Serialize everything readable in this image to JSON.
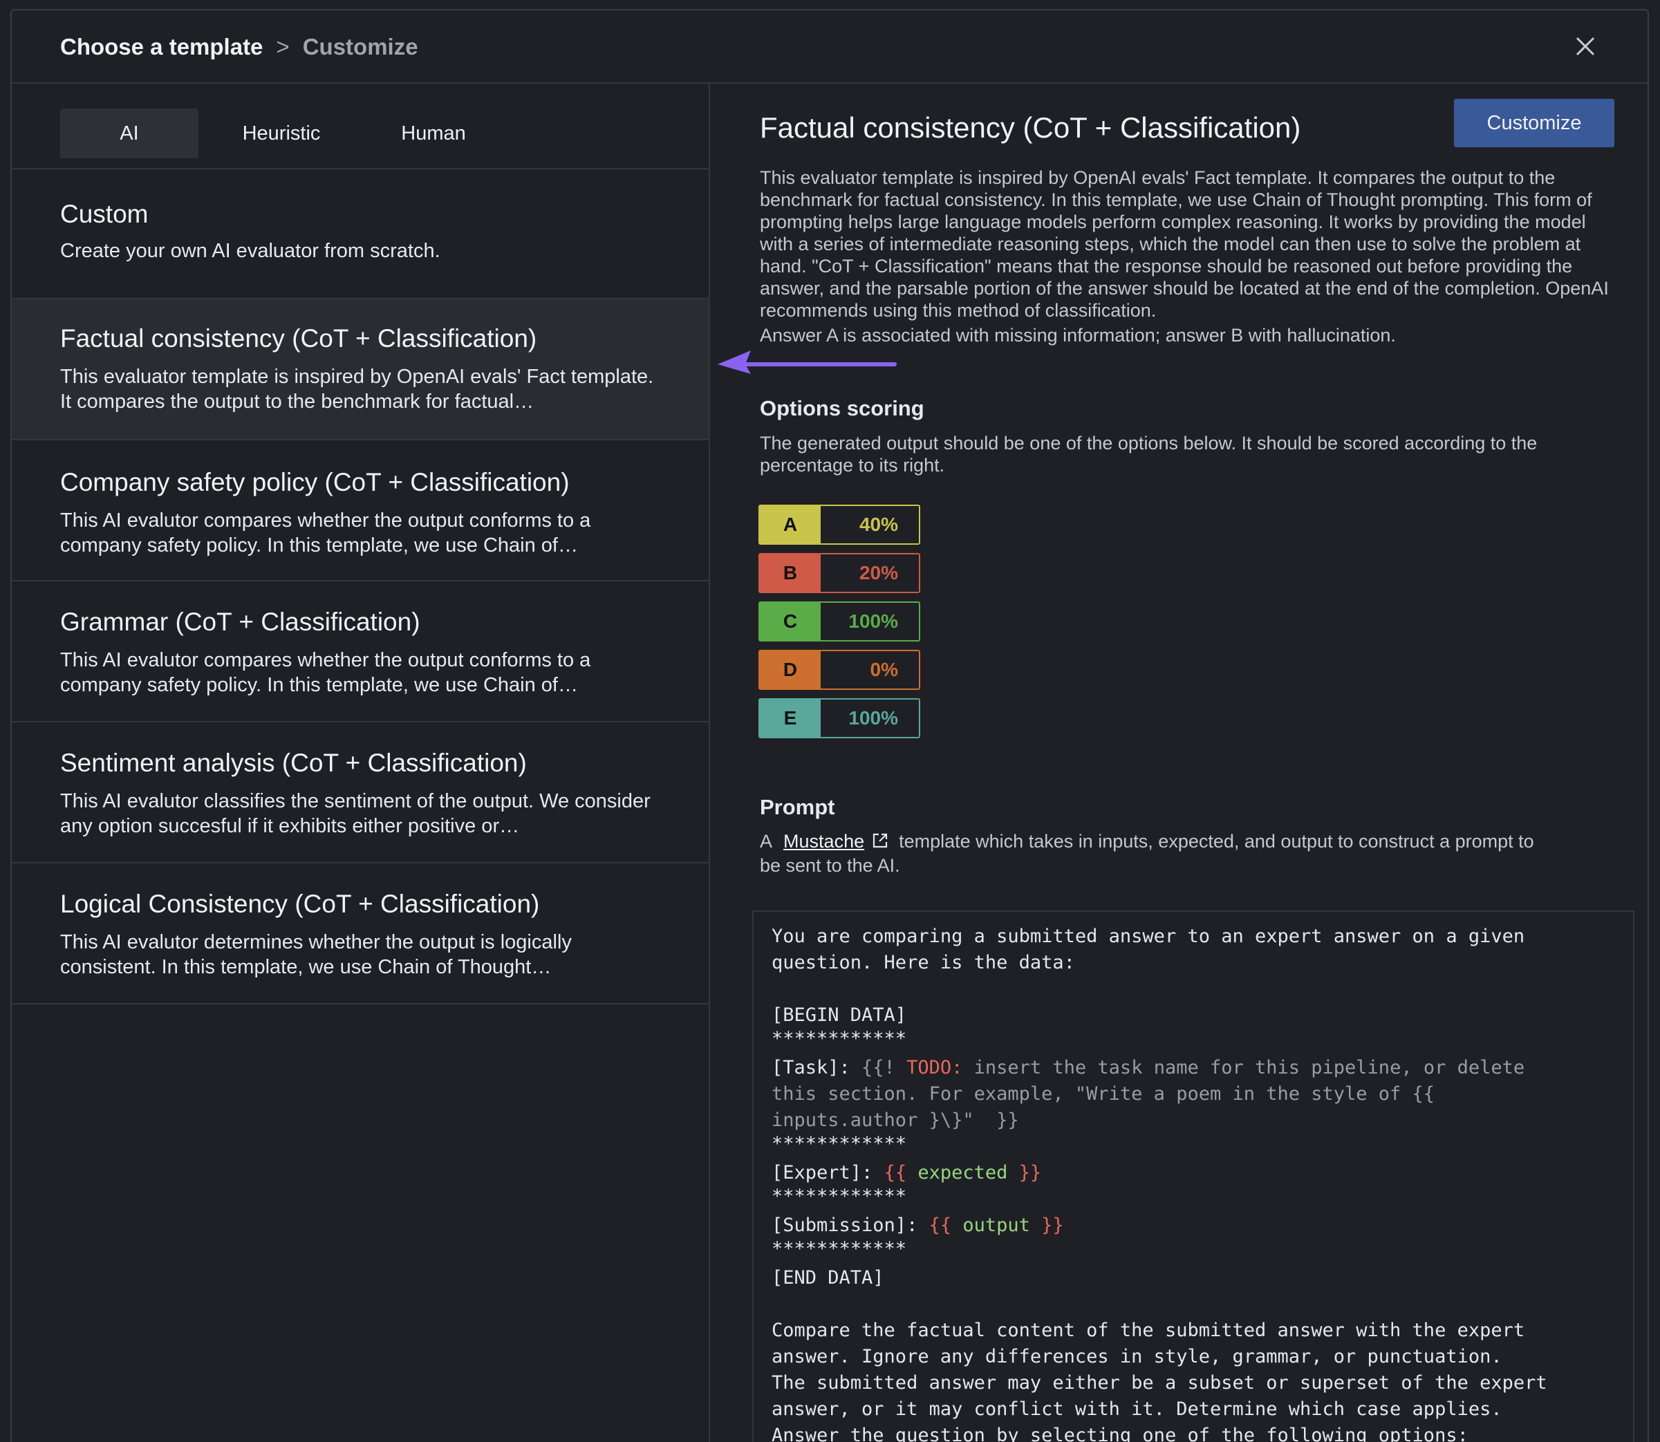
{
  "header": {
    "breadcrumb_current": "Choose a template",
    "breadcrumb_separator": ">",
    "breadcrumb_next": "Customize",
    "close_icon": "close-icon"
  },
  "tabs": [
    {
      "label": "AI",
      "active": true
    },
    {
      "label": "Heuristic",
      "active": false
    },
    {
      "label": "Human",
      "active": false
    }
  ],
  "templates": [
    {
      "title": "Custom",
      "description": "Create your own AI evaluator from scratch."
    },
    {
      "title": "Factual consistency (CoT + Classification)",
      "description": "This evaluator template is inspired by OpenAI evals' Fact template. It compares the output to the benchmark for factual…",
      "selected": true
    },
    {
      "title": "Company safety policy (CoT + Classification)",
      "description": "This AI evalutor compares whether the output conforms to a company safety policy. In this template, we use Chain of…"
    },
    {
      "title": "Grammar (CoT + Classification)",
      "description": "This AI evalutor compares whether the output conforms to a company safety policy. In this template, we use Chain of…"
    },
    {
      "title": "Sentiment analysis (CoT + Classification)",
      "description": "This AI evalutor classifies the sentiment of the output. We consider any option succesful if it exhibits either positive or…"
    },
    {
      "title": "Logical Consistency (CoT + Classification)",
      "description": "This AI evalutor determines whether the output is logically consistent. In this template, we use Chain of Thought…"
    }
  ],
  "detail": {
    "title": "Factual consistency (CoT + Classification)",
    "customize_label": "Customize",
    "description": "This evaluator template is inspired by OpenAI evals' Fact template. It compares the output to the benchmark for factual consistency. In this template, we use Chain of Thought prompting. This form of prompting helps large language models perform complex reasoning. It works by providing the model with a series of intermediate reasoning steps, which the model can then use to solve the problem at hand. \"CoT + Classification\" means that the response should be reasoned out before providing the answer, and the parsable portion of the answer should be located at the end of the completion. OpenAI recommends using this method of classification.",
    "note": "Answer A is associated with missing information; answer B with hallucination."
  },
  "options_scoring": {
    "heading": "Options scoring",
    "description": "The generated output should be one of the options below. It should be scored according to the percentage to its right.",
    "options": [
      {
        "letter": "A",
        "percent": "40%",
        "color": "#c9c44a"
      },
      {
        "letter": "B",
        "percent": "20%",
        "color": "#cf5a48"
      },
      {
        "letter": "C",
        "percent": "100%",
        "color": "#5aac48"
      },
      {
        "letter": "D",
        "percent": "0%",
        "color": "#cd6f2e"
      },
      {
        "letter": "E",
        "percent": "100%",
        "color": "#5aa79c"
      }
    ]
  },
  "prompt": {
    "heading": "Prompt",
    "desc_prefix": "A",
    "link_label": "Mustache",
    "desc_suffix": "template which takes in inputs, expected, and output to construct a prompt to",
    "desc_line2": "be sent to the AI.",
    "code": {
      "l1": "You are comparing a submitted answer to an expert answer on a given",
      "l2": "question. Here is the data:",
      "l3": "[BEGIN DATA]",
      "stars": "************",
      "task_label": "[Task]: ",
      "task_open": "{{! ",
      "task_todo": "TODO:",
      "task_text1": " insert the task name for this pipeline, or delete",
      "task_text2": "this section. For example, \"Write a poem in the style of {{",
      "task_text3": "inputs.author }\\}\"  }}",
      "expert_label": "[Expert]: ",
      "var_open": "{{",
      "var_expected": " expected ",
      "var_close": "}}",
      "submission_label": "[Submission]: ",
      "var_output": " output ",
      "end": "[END DATA]",
      "c1": "Compare the factual content of the submitted answer with the expert",
      "c2": "answer. Ignore any differences in style, grammar, or punctuation.",
      "c3": "The submitted answer may either be a subset or superset of the expert",
      "c4": "answer, or it may conflict with it. Determine which case applies.",
      "c5": "Answer the question by selecting one of the following options:"
    }
  },
  "colors": {
    "background": "#1f2025",
    "selected_row": "#2b2c31",
    "customize_button": "#3a5998",
    "arrow": "#8a63f0"
  }
}
